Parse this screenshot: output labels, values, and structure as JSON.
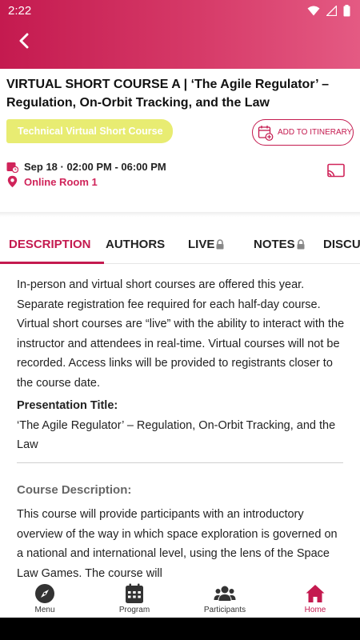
{
  "status_bar": {
    "time": "2:22"
  },
  "session": {
    "title": "VIRTUAL SHORT COURSE A | ‘The Agile Regulator’ – Regulation, On-Orbit Tracking, and the Law",
    "track": "Technical Virtual Short Course",
    "add_to_itinerary": "ADD TO ITINERARY",
    "date_time": "Sep 18 · 02:00 PM - 06:00 PM",
    "room": "Online Room 1"
  },
  "tabs": [
    {
      "label": "DESCRIPTION",
      "locked": false
    },
    {
      "label": "AUTHORS",
      "locked": false
    },
    {
      "label": "LIVE",
      "locked": true
    },
    {
      "label": "NOTES",
      "locked": true
    },
    {
      "label": "DISCUS",
      "locked": false
    }
  ],
  "description": {
    "intro": "In-person and virtual short courses are offered this year. Separate registration fee required for each half-day course. Virtual short courses are “live” with the ability to interact with the instructor and attendees in real-time. Virtual courses will not be recorded. Access links will be provided to registrants closer to the course date.",
    "presentation_title_label": "Presentation Title:",
    "presentation_title": "‘The Agile Regulator’ – Regulation, On-Orbit Tracking, and the Law",
    "course_description_label": "Course Description:",
    "course_description": "This course will provide participants with an introductory overview of the way in which space exploration is governed on a national and international level, using the lens of the Space Law Games. The course will"
  },
  "bottom_nav": [
    {
      "label": "Menu",
      "icon": "compass-icon",
      "active": false
    },
    {
      "label": "Program",
      "icon": "calendar-icon",
      "active": false
    },
    {
      "label": "Participants",
      "icon": "people-icon",
      "active": false
    },
    {
      "label": "Home",
      "icon": "home-icon",
      "active": true
    }
  ],
  "colors": {
    "brand": "#c41a4f",
    "header_gradient_end": "#e45a83",
    "track_badge": "#e8ec72",
    "room_text": "#d0245a"
  }
}
